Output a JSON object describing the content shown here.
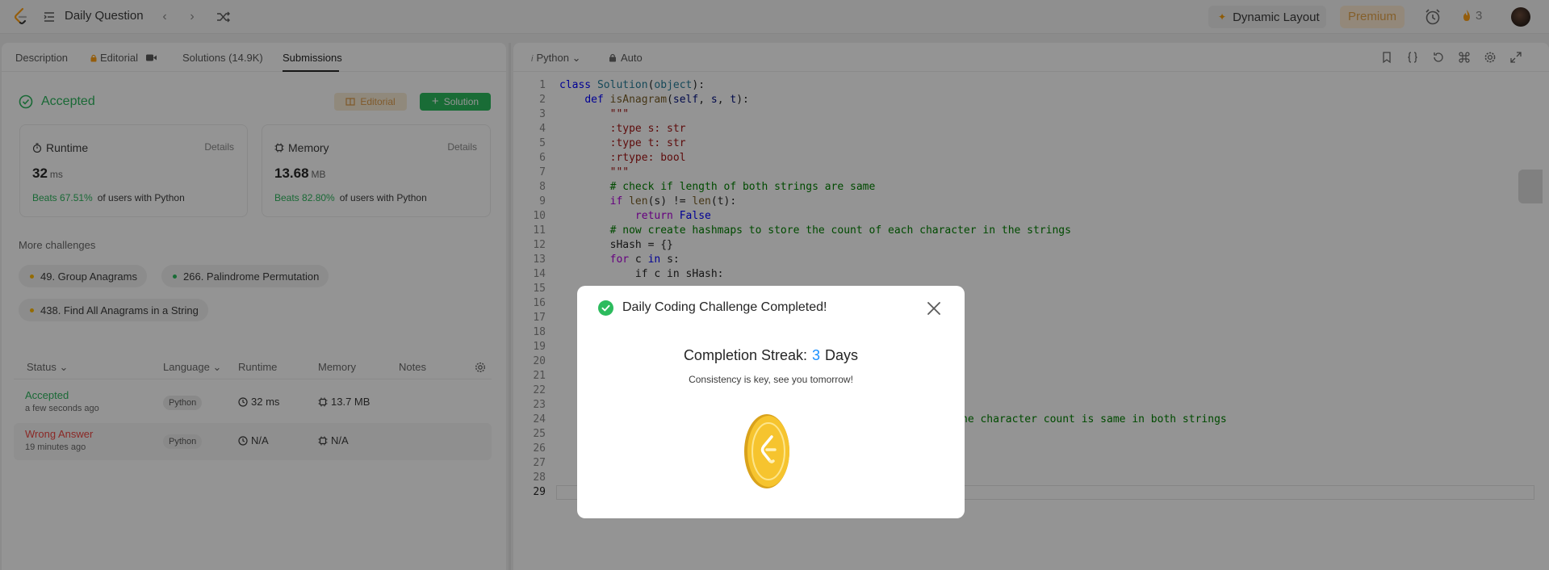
{
  "topnav": {
    "title": "Daily Question",
    "dynamic_layout": "Dynamic Layout",
    "premium": "Premium",
    "streak_count": "3"
  },
  "tabs": {
    "description": "Description",
    "editorial": "Editorial",
    "solutions": "Solutions (14.9K)",
    "submissions": "Submissions"
  },
  "result": {
    "status": "Accepted",
    "editorial_btn": "Editorial",
    "solution_btn": "Solution"
  },
  "runtime": {
    "label": "Runtime",
    "details": "Details",
    "value": "32",
    "unit": "ms",
    "beats": "Beats 67.51%",
    "beats_suffix": "of users with Python"
  },
  "memory": {
    "label": "Memory",
    "details": "Details",
    "value": "13.68",
    "unit": "MB",
    "beats": "Beats 82.80%",
    "beats_suffix": "of users with Python"
  },
  "challenges": {
    "heading": "More challenges",
    "items": [
      {
        "label": "49. Group Anagrams",
        "dot": "#ffb800"
      },
      {
        "label": "266. Palindrome Permutation",
        "dot": "#2cbb5d"
      },
      {
        "label": "438. Find All Anagrams in a String",
        "dot": "#ffb800"
      }
    ]
  },
  "submissions": {
    "headers": {
      "status": "Status",
      "language": "Language",
      "runtime": "Runtime",
      "memory": "Memory",
      "notes": "Notes"
    },
    "rows": [
      {
        "status": "Accepted",
        "time": "a few seconds ago",
        "language": "Python",
        "runtime": "32 ms",
        "memory": "13.7 MB"
      },
      {
        "status": "Wrong Answer",
        "time": "19 minutes ago",
        "language": "Python",
        "runtime": "N/A",
        "memory": "N/A"
      }
    ]
  },
  "editor": {
    "language": "Python",
    "mode": "Auto",
    "line_numbers": [
      "1",
      "2",
      "3",
      "4",
      "5",
      "6",
      "7",
      "8",
      "9",
      "10",
      "11",
      "12",
      "13",
      "14",
      "15",
      "16",
      "17",
      "18",
      "19",
      "20",
      "21",
      "22",
      "23",
      "24",
      "25",
      "26",
      "27",
      "28",
      "29"
    ],
    "code_line_14": "if c in sHash:",
    "code_line_24_fragment": "he character count is same in both strings"
  },
  "modal": {
    "title": "Daily Coding Challenge Completed!",
    "streak_label": "Completion Streak:",
    "streak_value": "3",
    "streak_unit": "Days",
    "message": "Consistency is key, see you tomorrow!"
  },
  "colors": {
    "accepted": "#2db55d",
    "wrong": "#ef4743",
    "brand_orange": "#ffa116",
    "streak_blue": "#1a90ff"
  }
}
